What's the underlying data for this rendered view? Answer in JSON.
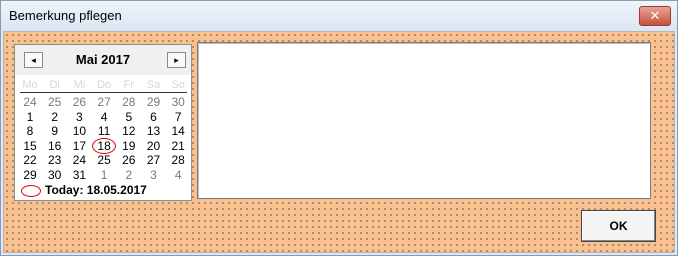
{
  "window": {
    "title": "Bemerkung pflegen",
    "close_glyph": "✕"
  },
  "calendar": {
    "prev_glyph": "◂",
    "next_glyph": "▸",
    "month_title": "Mai 2017",
    "weekdays": [
      "Mo",
      "Di",
      "Mi",
      "Do",
      "Fr",
      "Sa",
      "So"
    ],
    "weeks": [
      [
        {
          "d": "24",
          "o": true
        },
        {
          "d": "25",
          "o": true
        },
        {
          "d": "26",
          "o": true
        },
        {
          "d": "27",
          "o": true
        },
        {
          "d": "28",
          "o": true
        },
        {
          "d": "29",
          "o": true
        },
        {
          "d": "30",
          "o": true
        }
      ],
      [
        {
          "d": "1"
        },
        {
          "d": "2"
        },
        {
          "d": "3"
        },
        {
          "d": "4"
        },
        {
          "d": "5"
        },
        {
          "d": "6"
        },
        {
          "d": "7"
        }
      ],
      [
        {
          "d": "8"
        },
        {
          "d": "9"
        },
        {
          "d": "10"
        },
        {
          "d": "11"
        },
        {
          "d": "12"
        },
        {
          "d": "13"
        },
        {
          "d": "14"
        }
      ],
      [
        {
          "d": "15"
        },
        {
          "d": "16"
        },
        {
          "d": "17"
        },
        {
          "d": "18",
          "t": true
        },
        {
          "d": "19"
        },
        {
          "d": "20"
        },
        {
          "d": "21"
        }
      ],
      [
        {
          "d": "22"
        },
        {
          "d": "23"
        },
        {
          "d": "24"
        },
        {
          "d": "25"
        },
        {
          "d": "26"
        },
        {
          "d": "27"
        },
        {
          "d": "28"
        }
      ],
      [
        {
          "d": "29"
        },
        {
          "d": "30"
        },
        {
          "d": "31"
        },
        {
          "d": "1",
          "o": true
        },
        {
          "d": "2",
          "o": true
        },
        {
          "d": "3",
          "o": true
        },
        {
          "d": "4",
          "o": true
        }
      ]
    ],
    "today_label": "Today: 18.05.2017"
  },
  "remark": {
    "value": ""
  },
  "ok_label": "OK",
  "colors": {
    "background": "#f8c18f",
    "today_marker": "#dd0000",
    "close_button": "#c4533e"
  }
}
